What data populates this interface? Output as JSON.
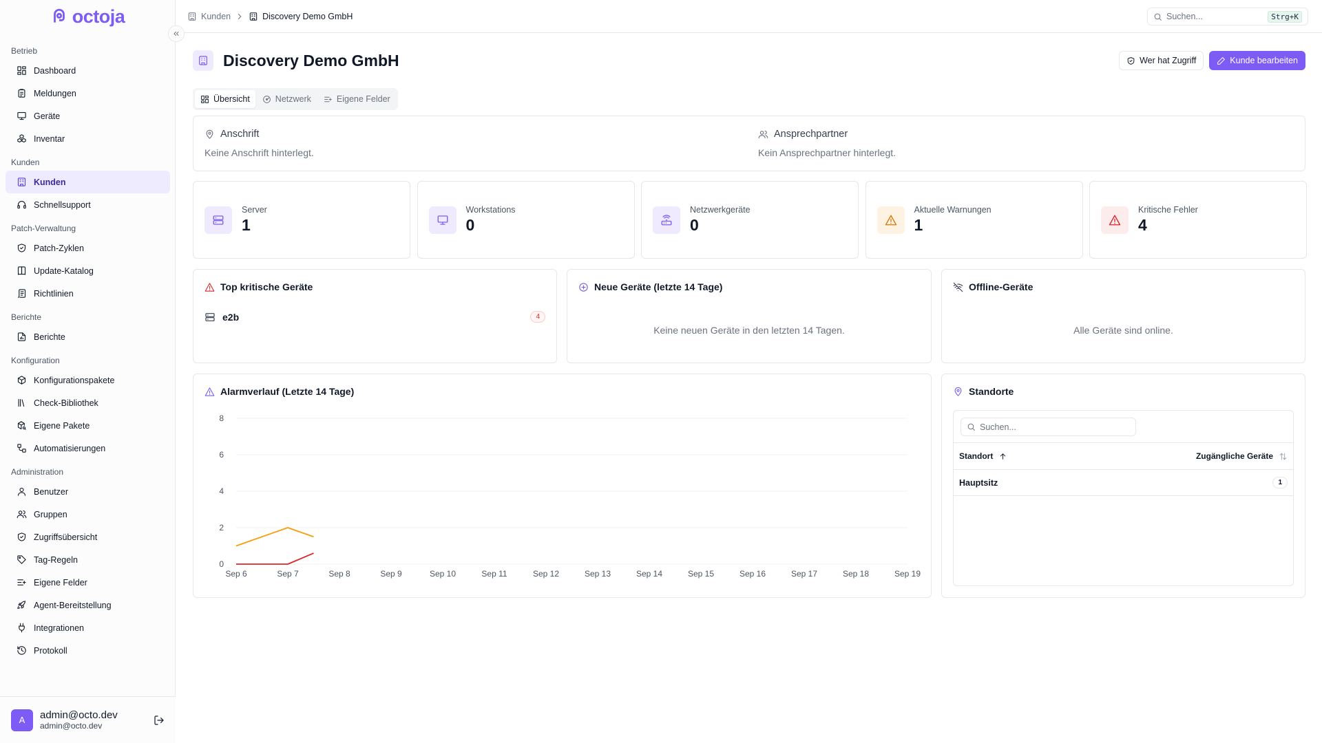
{
  "brand": {
    "name": "octoja",
    "accent": "#7c5cf5"
  },
  "sidebar": {
    "groups": [
      {
        "label": "Betrieb",
        "items": [
          {
            "label": "Dashboard",
            "icon": "dashboard-icon"
          },
          {
            "label": "Meldungen",
            "icon": "clipboard-icon"
          },
          {
            "label": "Geräte",
            "icon": "monitor-icon"
          },
          {
            "label": "Inventar",
            "icon": "boxes-icon"
          }
        ]
      },
      {
        "label": "Kunden",
        "items": [
          {
            "label": "Kunden",
            "icon": "building-icon",
            "active": true
          },
          {
            "label": "Schnellsupport",
            "icon": "headset-icon"
          }
        ]
      },
      {
        "label": "Patch-Verwaltung",
        "items": [
          {
            "label": "Patch-Zyklen",
            "icon": "shield-check-icon"
          },
          {
            "label": "Update-Katalog",
            "icon": "book-icon"
          },
          {
            "label": "Richtlinien",
            "icon": "scroll-icon"
          }
        ]
      },
      {
        "label": "Berichte",
        "items": [
          {
            "label": "Berichte",
            "icon": "file-chart-icon"
          }
        ]
      },
      {
        "label": "Konfiguration",
        "items": [
          {
            "label": "Konfigurationspakete",
            "icon": "package-icon"
          },
          {
            "label": "Check-Bibliothek",
            "icon": "library-icon"
          },
          {
            "label": "Eigene Pakete",
            "icon": "package-search-icon"
          },
          {
            "label": "Automatisierungen",
            "icon": "workflow-icon"
          }
        ]
      },
      {
        "label": "Administration",
        "items": [
          {
            "label": "Benutzer",
            "icon": "user-icon"
          },
          {
            "label": "Gruppen",
            "icon": "users-icon"
          },
          {
            "label": "Zugriffsübersicht",
            "icon": "shield-icon"
          },
          {
            "label": "Tag-Regeln",
            "icon": "tag-icon"
          },
          {
            "label": "Eigene Felder",
            "icon": "list-plus-icon"
          },
          {
            "label": "Agent-Bereitstellung",
            "icon": "rocket-icon"
          },
          {
            "label": "Integrationen",
            "icon": "plug-icon"
          },
          {
            "label": "Protokoll",
            "icon": "history-icon"
          }
        ]
      }
    ],
    "user": {
      "initial": "A",
      "name": "admin@octo.dev",
      "email": "admin@octo.dev"
    }
  },
  "topbar": {
    "breadcrumbs": [
      "Kunden",
      "Discovery Demo GmbH"
    ],
    "search_placeholder": "Suchen...",
    "shortcut": "Strg+K"
  },
  "page": {
    "title": "Discovery Demo GmbH",
    "actions": {
      "access": "Wer hat Zugriff",
      "edit": "Kunde bearbeiten"
    },
    "tabs": [
      "Übersicht",
      "Netzwerk",
      "Eigene Felder"
    ],
    "address": {
      "title": "Anschrift",
      "text": "Keine Anschrift hinterlegt."
    },
    "contact": {
      "title": "Ansprechpartner",
      "text": "Kein Ansprechpartner hinterlegt."
    }
  },
  "stats": [
    {
      "label": "Server",
      "value": "1",
      "icon": "server-icon",
      "color": "#7c5cf5",
      "bg": "#efeafe"
    },
    {
      "label": "Workstations",
      "value": "0",
      "icon": "monitor-icon",
      "color": "#7c5cf5",
      "bg": "#efeafe"
    },
    {
      "label": "Netzwerkgeräte",
      "value": "0",
      "icon": "router-icon",
      "color": "#7c5cf5",
      "bg": "#efeafe"
    },
    {
      "label": "Aktuelle Warnungen",
      "value": "1",
      "icon": "warning-icon",
      "color": "#d97706",
      "bg": "#fef3e2"
    },
    {
      "label": "Kritische Fehler",
      "value": "4",
      "icon": "critical-icon",
      "color": "#dc2626",
      "bg": "#fdecec"
    }
  ],
  "critical_devices": {
    "title": "Top kritische Geräte",
    "items": [
      {
        "name": "e2b",
        "count": "4"
      }
    ]
  },
  "new_devices": {
    "title": "Neue Geräte (letzte 14 Tage)",
    "empty": "Keine neuen Geräte in den letzten 14 Tagen."
  },
  "offline_devices": {
    "title": "Offline-Geräte",
    "empty": "Alle Geräte sind online."
  },
  "alarm_chart": {
    "title": "Alarmverlauf (Letzte 14 Tage)"
  },
  "chart_data": {
    "type": "line",
    "x": [
      "Sep 6",
      "Sep 7",
      "Sep 8",
      "Sep 9",
      "Sep 10",
      "Sep 11",
      "Sep 12",
      "Sep 13",
      "Sep 14",
      "Sep 15",
      "Sep 16",
      "Sep 17",
      "Sep 18",
      "Sep 19"
    ],
    "series": [
      {
        "color": "#f59e0b",
        "values": [
          1,
          2,
          1.5
        ]
      },
      {
        "color": "#dc2626",
        "values": [
          0,
          0,
          0.6
        ]
      }
    ],
    "x_positions": [
      0,
      1,
      1.5
    ],
    "ylim": [
      0,
      8
    ],
    "yticks": [
      0,
      2,
      4,
      6,
      8
    ],
    "grid": true
  },
  "locations": {
    "title": "Standorte",
    "search_placeholder": "Suchen...",
    "columns": [
      "Standort",
      "Zugängliche Geräte"
    ],
    "rows": [
      {
        "name": "Hauptsitz",
        "count": "1"
      }
    ]
  }
}
